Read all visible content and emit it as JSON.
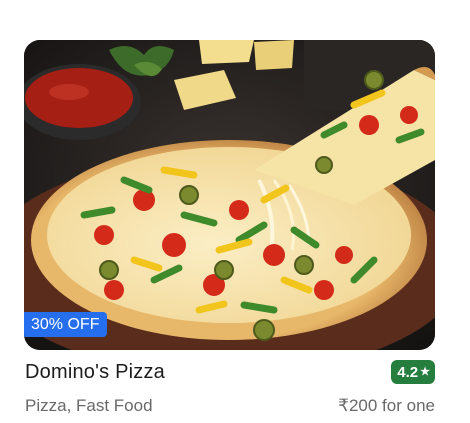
{
  "card": {
    "offer": "30% OFF",
    "name": "Domino's Pizza",
    "rating": "4.2",
    "rating_icon": "star-icon",
    "cuisine": "Pizza, Fast Food",
    "price": "₹200 for one"
  },
  "colors": {
    "offer_badge": "#256fef",
    "rating_badge": "#267e3e",
    "name_text": "#1c1c1c",
    "meta_text": "#696969"
  },
  "image": {
    "subject": "pizza-photo"
  }
}
